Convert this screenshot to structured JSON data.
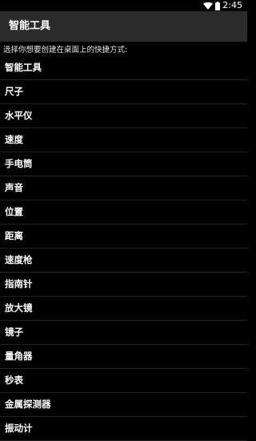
{
  "status_bar": {
    "time": "2:45",
    "icons": [
      "wifi-icon",
      "battery-icon"
    ]
  },
  "app_bar": {
    "title": "智能工具"
  },
  "prompt": "选择你想要创建在桌面上的快捷方式:",
  "tools": [
    "智能工具",
    "尺子",
    "水平仪",
    "速度",
    "手电筒",
    "声音",
    "位置",
    "距离",
    "速度枪",
    "指南针",
    "放大镜",
    "镜子",
    "量角器",
    "秒表",
    "金属探测器",
    "振动计"
  ],
  "colors": {
    "background": "#000000",
    "app_bar": "#2b2b2b",
    "divider": "#222222",
    "text": "#ffffff"
  }
}
